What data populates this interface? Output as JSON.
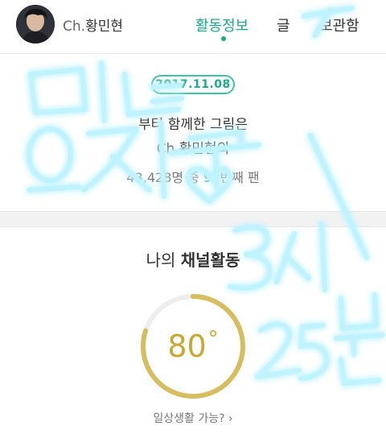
{
  "header": {
    "channel_prefix": "Ch.",
    "channel_name": "황민현",
    "tabs": [
      {
        "label": "활동정보",
        "active": true
      },
      {
        "label": "글",
        "active": false
      },
      {
        "label": "보관함",
        "active": false
      }
    ],
    "accent_color": "#1aab8a"
  },
  "fan_card": {
    "date": "2017.11.08",
    "line1": "부터 함께한 그림은",
    "channel_prefix": "Ch.",
    "channel_name": "황민현의",
    "count": "43,428명 중",
    "rank": "99",
    "rank_suffix": "번째 팬"
  },
  "activity": {
    "title_plain": "나의",
    "title_strong": "채널활동",
    "gauge_value": "80",
    "gauge_unit": "°",
    "gauge_fraction": 0.8,
    "gauge_color": "#d6bd5e",
    "question": "일상생활 가능? ›"
  },
  "overlay": {
    "handwriting_color": "#4fd8ff",
    "lines": [
      "미녀",
      "오지구",
      "3시",
      "25분"
    ]
  }
}
